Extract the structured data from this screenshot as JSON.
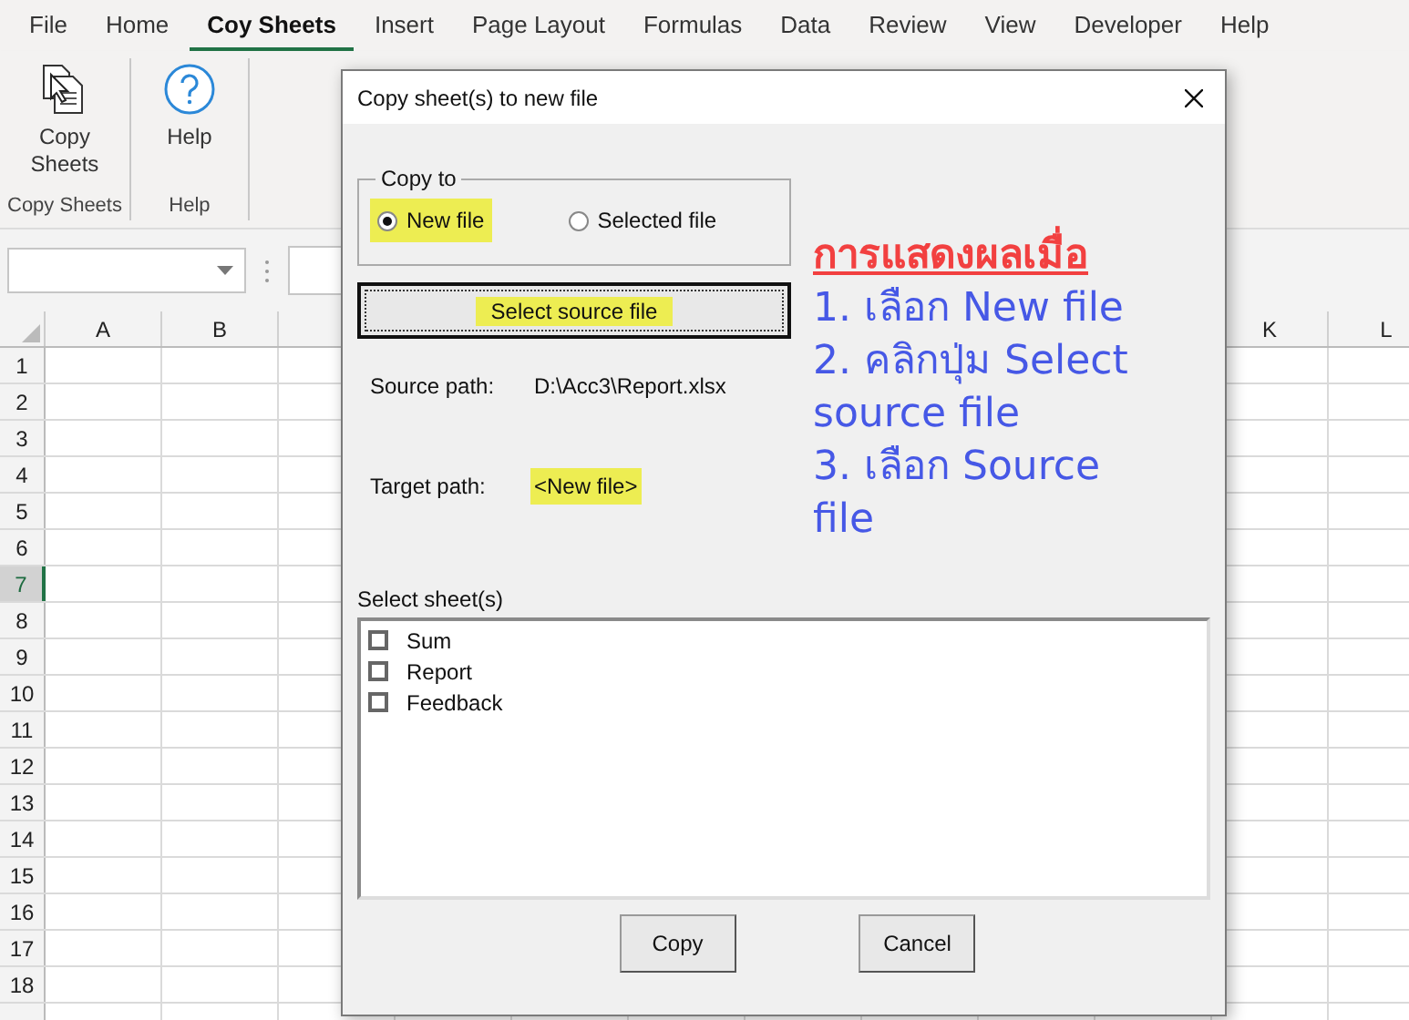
{
  "menu_tabs": [
    {
      "label": "File",
      "selected": false
    },
    {
      "label": "Home",
      "selected": false
    },
    {
      "label": "Coy Sheets",
      "selected": true
    },
    {
      "label": "Insert",
      "selected": false
    },
    {
      "label": "Page Layout",
      "selected": false
    },
    {
      "label": "Formulas",
      "selected": false
    },
    {
      "label": "Data",
      "selected": false
    },
    {
      "label": "Review",
      "selected": false
    },
    {
      "label": "View",
      "selected": false
    },
    {
      "label": "Developer",
      "selected": false
    },
    {
      "label": "Help",
      "selected": false
    }
  ],
  "ribbon": {
    "groups": [
      {
        "name": "Copy Sheets",
        "button": {
          "kind": "copy",
          "label": "Copy Sheets"
        }
      },
      {
        "name": "Help",
        "button": {
          "kind": "help",
          "label": "Help"
        }
      }
    ]
  },
  "sheet": {
    "columns_left": [
      "A",
      "B"
    ],
    "columns_right": [
      "K",
      "L"
    ],
    "rows": [
      {
        "label": "1",
        "selected": false
      },
      {
        "label": "2",
        "selected": false
      },
      {
        "label": "3",
        "selected": false
      },
      {
        "label": "4",
        "selected": false
      },
      {
        "label": "5",
        "selected": false
      },
      {
        "label": "6",
        "selected": false
      },
      {
        "label": "7",
        "selected": true
      },
      {
        "label": "8",
        "selected": false
      },
      {
        "label": "9",
        "selected": false
      },
      {
        "label": "10",
        "selected": false
      },
      {
        "label": "11",
        "selected": false
      },
      {
        "label": "12",
        "selected": false
      },
      {
        "label": "13",
        "selected": false
      },
      {
        "label": "14",
        "selected": false
      },
      {
        "label": "15",
        "selected": false
      },
      {
        "label": "16",
        "selected": false
      },
      {
        "label": "17",
        "selected": false
      },
      {
        "label": "18",
        "selected": false
      }
    ]
  },
  "dialog": {
    "title": "Copy sheet(s) to new file",
    "copy_to": {
      "label": "Copy to",
      "options": [
        {
          "label": "New file",
          "selected": true,
          "highlighted": true
        },
        {
          "label": "Selected file",
          "selected": false,
          "highlighted": false
        }
      ]
    },
    "select_button": {
      "label": "Select source file",
      "highlighted": true
    },
    "source_path": {
      "label": "Source path:",
      "value": "D:\\Acc3\\Report.xlsx",
      "highlighted": false
    },
    "target_path": {
      "label": "Target path:",
      "value": "<New file>",
      "highlighted": true
    },
    "note": {
      "heading": "การแสดงผลเมื่อ",
      "steps": [
        "1. เลือก New file",
        "2. คลิกปุ่ม Select source file",
        "3. เลือก Source file"
      ]
    },
    "sheets": {
      "label": "Select sheet(s)",
      "items": [
        {
          "label": "Sum",
          "checked": false
        },
        {
          "label": "Report",
          "checked": false
        },
        {
          "label": "Feedback",
          "checked": false
        }
      ]
    },
    "buttons": [
      "Copy",
      "Cancel"
    ]
  }
}
